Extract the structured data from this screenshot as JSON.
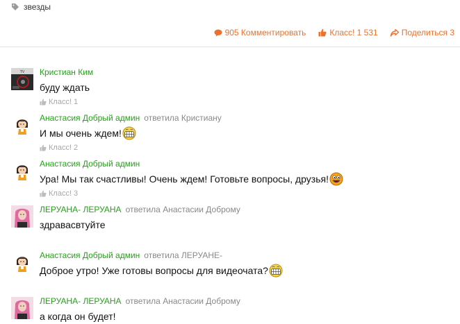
{
  "tag": {
    "icon": "tag-icon",
    "label": "звезды"
  },
  "actions": {
    "comments_label": "905 Комментировать",
    "like_label": "Класс! 1 531",
    "share_label": "Поделиться 3",
    "color": "#eb722e"
  },
  "colors": {
    "author": "#27a01b",
    "muted": "#888888",
    "divider": "#e3e3e3"
  },
  "comments": [
    {
      "author": "Кристиан Ким",
      "replied_prefix": "",
      "replied_to": "",
      "text": "буду ждать",
      "smiley": "",
      "like_label": "Класс! 1"
    },
    {
      "author": "Анастасия Добрый админ",
      "replied_prefix": "ответила",
      "replied_to": "Кристиану",
      "text": "И мы очень ждем!",
      "smiley": "grin-smiley",
      "like_label": "Класс! 2"
    },
    {
      "author": "Анастасия Добрый админ",
      "replied_prefix": "",
      "replied_to": "",
      "text": "Ура! Мы так счастливы! Очень ждем! Готовьте вопросы, друзья!",
      "smiley": "laugh-smiley",
      "like_label": "Класс! 3"
    },
    {
      "author": "ЛЕРУАНА- ЛЕРУАНА",
      "replied_prefix": "ответила",
      "replied_to": "Анастасии Доброму",
      "text": "здравасвтуйте",
      "smiley": "",
      "like_label": ""
    },
    {
      "author": "Анастасия Добрый админ",
      "replied_prefix": "ответила",
      "replied_to": "ЛЕРУАНЕ-",
      "text": "Доброе утро! Уже готовы вопросы для видеочата?",
      "smiley": "grin-smiley",
      "like_label": ""
    },
    {
      "author": "ЛЕРУАНА- ЛЕРУАНА",
      "replied_prefix": "ответила",
      "replied_to": "Анастасии Доброму",
      "text": "а когда он будет!",
      "smiley": "",
      "like_label": ""
    }
  ]
}
